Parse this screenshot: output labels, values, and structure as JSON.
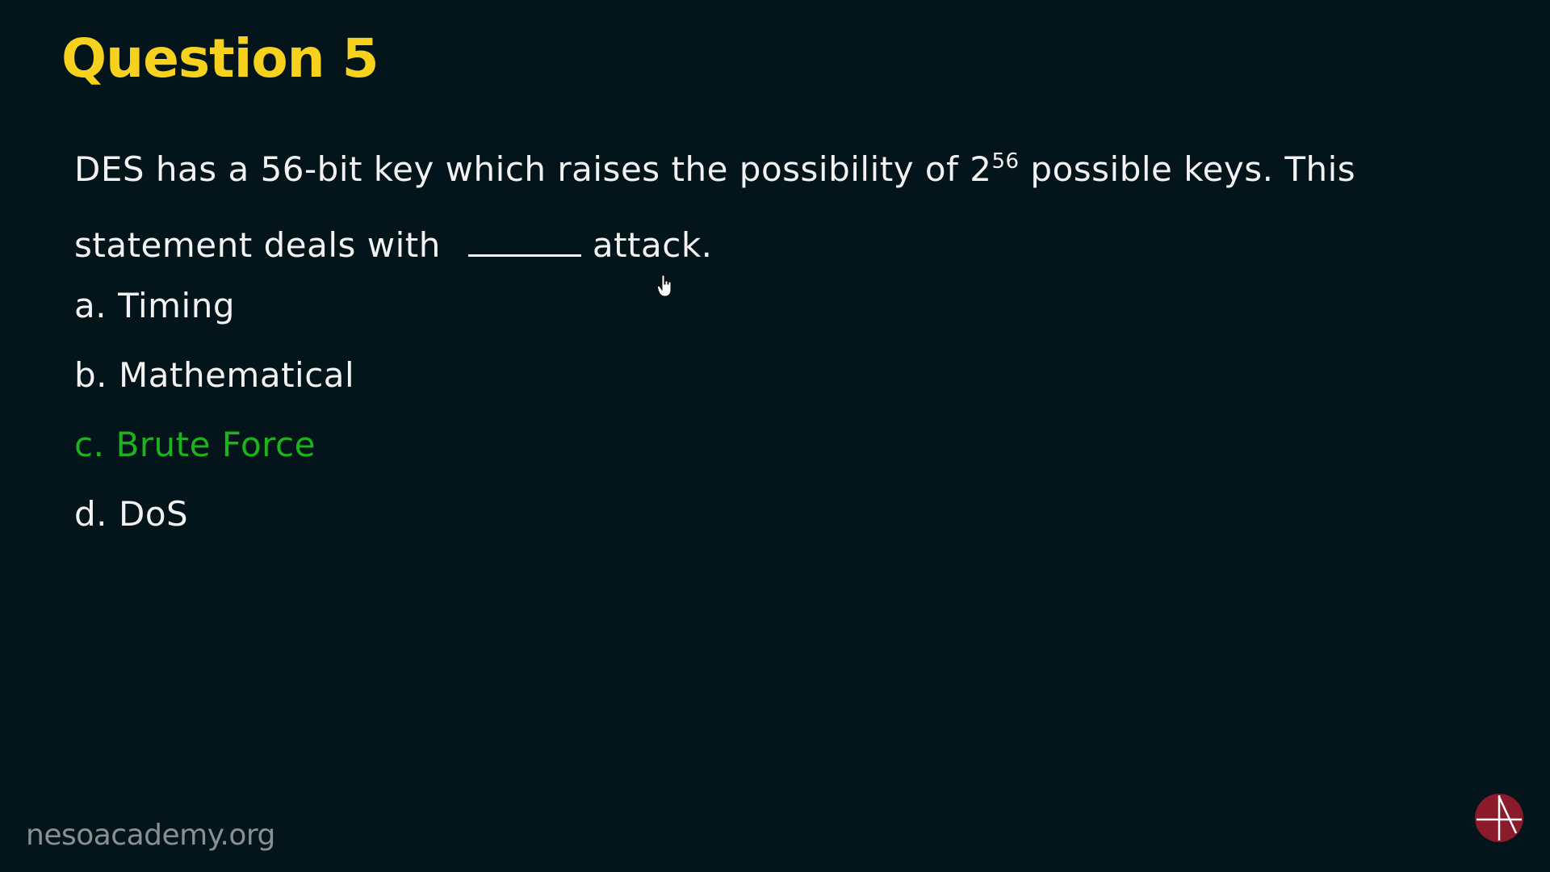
{
  "slide": {
    "title": "Question 5",
    "question": {
      "line1_before_sup": "DES has a 56-bit key which raises the possibility of 2",
      "superscript": "56",
      "line1_after_sup": " possible keys. This",
      "line2_before_blank": "statement deals with",
      "line2_after_blank": "attack."
    },
    "options": [
      {
        "letter": "a.",
        "text": "Timing",
        "correct": false
      },
      {
        "letter": "b.",
        "text": "Mathematical",
        "correct": false
      },
      {
        "letter": "c.",
        "text": "Brute Force",
        "correct": true
      },
      {
        "letter": "d.",
        "text": "DoS",
        "correct": false
      }
    ],
    "watermark": "nesoacademy.org",
    "icons": {
      "logo": "neso-academy-logo-icon",
      "cursor": "hand-pointer-icon"
    },
    "colors": {
      "background": "#03141a",
      "title": "#f6d21e",
      "text": "#f2f2f2",
      "correct": "#1db31d",
      "watermark": "#8a8f92",
      "logo": "#8b1a2b"
    }
  }
}
